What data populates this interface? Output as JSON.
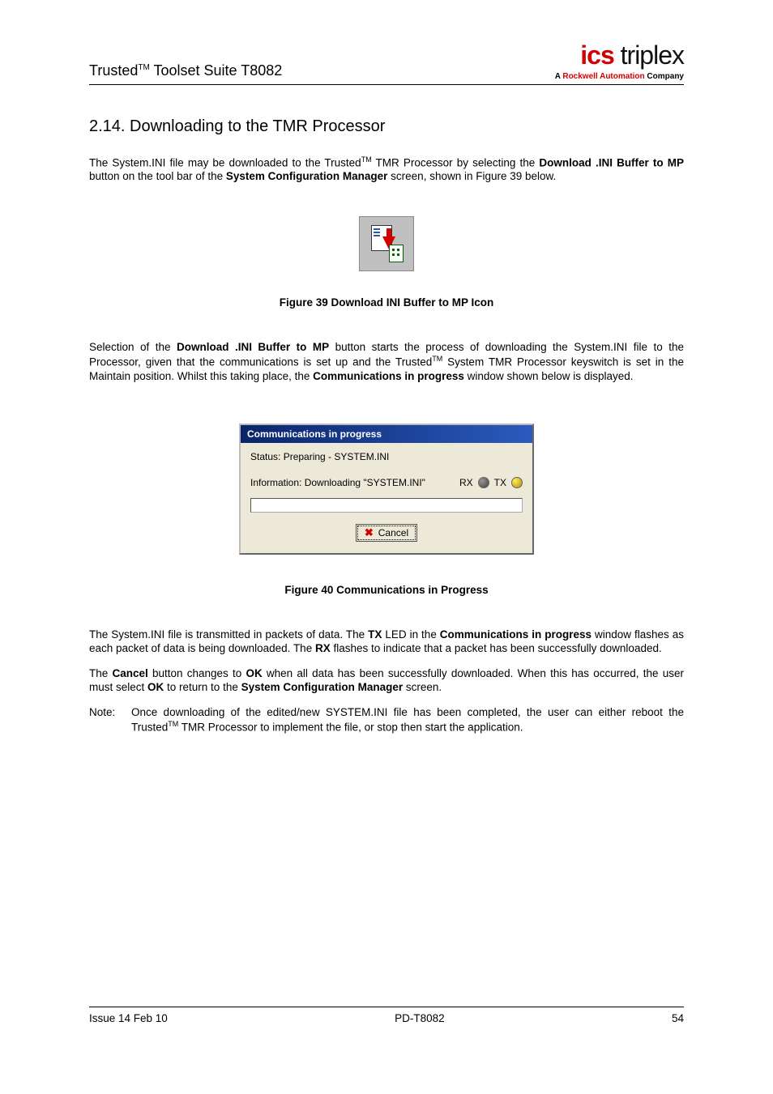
{
  "header": {
    "title_prefix": "Trusted",
    "title_tm": "TM",
    "title_suffix": " Toolset Suite T8082",
    "logo": {
      "word1": "ics",
      "word2": " triplex",
      "sub_prefix": "A ",
      "sub_brand": "Rockwell Automation",
      "sub_suffix": " Company"
    }
  },
  "section": {
    "number": "2.14.",
    "title": "Downloading to the TMR Processor"
  },
  "para1": {
    "t1": "The System.INI file may be downloaded to the Trusted",
    "tm": "TM",
    "t2": " TMR Processor by selecting the ",
    "b1": "Download .INI Buffer to MP",
    "t3": " button on the tool bar of the ",
    "b2": "System Configuration Manager",
    "t4": " screen, shown in Figure 39 below."
  },
  "caption39": "Figure 39 Download INI Buffer to MP Icon",
  "para2": {
    "t1": "Selection of the ",
    "b1": "Download .INI Buffer to MP",
    "t2": " button starts the process of downloading the System.INI file to the Processor, given that the communications is set up and the Trusted",
    "tm": "TM",
    "t3": " System TMR Processor keyswitch is set in the Maintain position.  Whilst this taking place, the ",
    "b2": "Communications in progress",
    "t4": " window shown below is displayed."
  },
  "dialog": {
    "title": "Communications in progress",
    "status": "Status:  Preparing - SYSTEM.INI",
    "info": "Information:  Downloading \"SYSTEM.INI\"",
    "rx": "RX",
    "tx": "TX",
    "cancel": "Cancel"
  },
  "caption40": "Figure 40 Communications in Progress",
  "para3": {
    "t1": "The System.INI file is transmitted in packets of data.  The ",
    "b1": "TX",
    "t2": " LED in the ",
    "b2": "Communications in progress",
    "t3": " window flashes as each packet of data is being downloaded.  The ",
    "b3": "RX",
    "t4": " flashes to indicate that a packet has been successfully downloaded."
  },
  "para4": {
    "t1": "The ",
    "b1": "Cancel",
    "t2": " button changes to ",
    "b2": "OK",
    "t3": " when all data has been successfully downloaded.  When this has occurred, the user must select ",
    "b3": "OK",
    "t4": " to return to the ",
    "b4": "System Configuration Manager",
    "t5": " screen."
  },
  "note": {
    "label": "Note:",
    "t1": "Once downloading of the edited/new SYSTEM.INI file has been completed, the user can either reboot the Trusted",
    "tm": "TM",
    "t2": " TMR Processor to implement the file, or stop then start the application."
  },
  "footer": {
    "left": "Issue 14 Feb 10",
    "center": "PD-T8082",
    "right": "54"
  }
}
